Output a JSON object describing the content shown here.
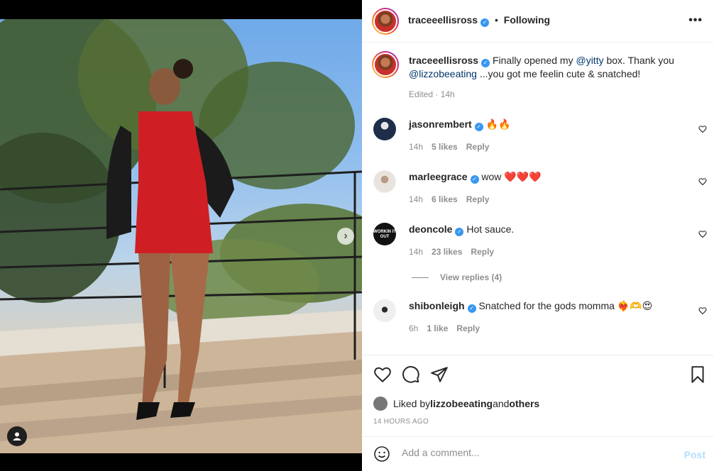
{
  "post": {
    "author": "traceeellisross",
    "follow_status": "Following",
    "separator": "•",
    "more_icon": "more-horizontal-icon"
  },
  "caption": {
    "author": "traceeellisross",
    "text_1": "Finally opened my ",
    "mention_1": "@yitty",
    "text_2": " box. Thank you ",
    "mention_2": "@lizzobeeating",
    "text_3": " ...you got me feelin cute & snatched!",
    "edited": "Edited",
    "time": "14h"
  },
  "comments": [
    {
      "user": "jasonrembert",
      "text": "🔥🔥",
      "time": "14h",
      "likes": "5 likes",
      "reply": "Reply"
    },
    {
      "user": "marleegrace",
      "text": "wow ❤️❤️❤️",
      "time": "14h",
      "likes": "6 likes",
      "reply": "Reply"
    },
    {
      "user": "deoncole",
      "text": "Hot sauce.",
      "time": "14h",
      "likes": "23 likes",
      "reply": "Reply",
      "avatar_text": "WORKIN IT OUT"
    },
    {
      "user": "shibonleigh",
      "text": "Snatched for the gods momma ❤️‍🔥🫶😍",
      "time": "6h",
      "likes": "1 like",
      "reply": "Reply"
    }
  ],
  "view_replies": "View replies (4)",
  "likes": {
    "prefix": "Liked by ",
    "user": "lizzobeeating",
    "middle": " and ",
    "others": "others"
  },
  "timestamp": "14 HOURS AGO",
  "comment_input": {
    "placeholder": "Add a comment...",
    "post_label": "Post"
  },
  "carousel": {
    "slides": 4,
    "active": 0
  },
  "colors": {
    "link": "#00376b",
    "verified": "#3897f0",
    "post_disabled": "#b2dffc"
  }
}
